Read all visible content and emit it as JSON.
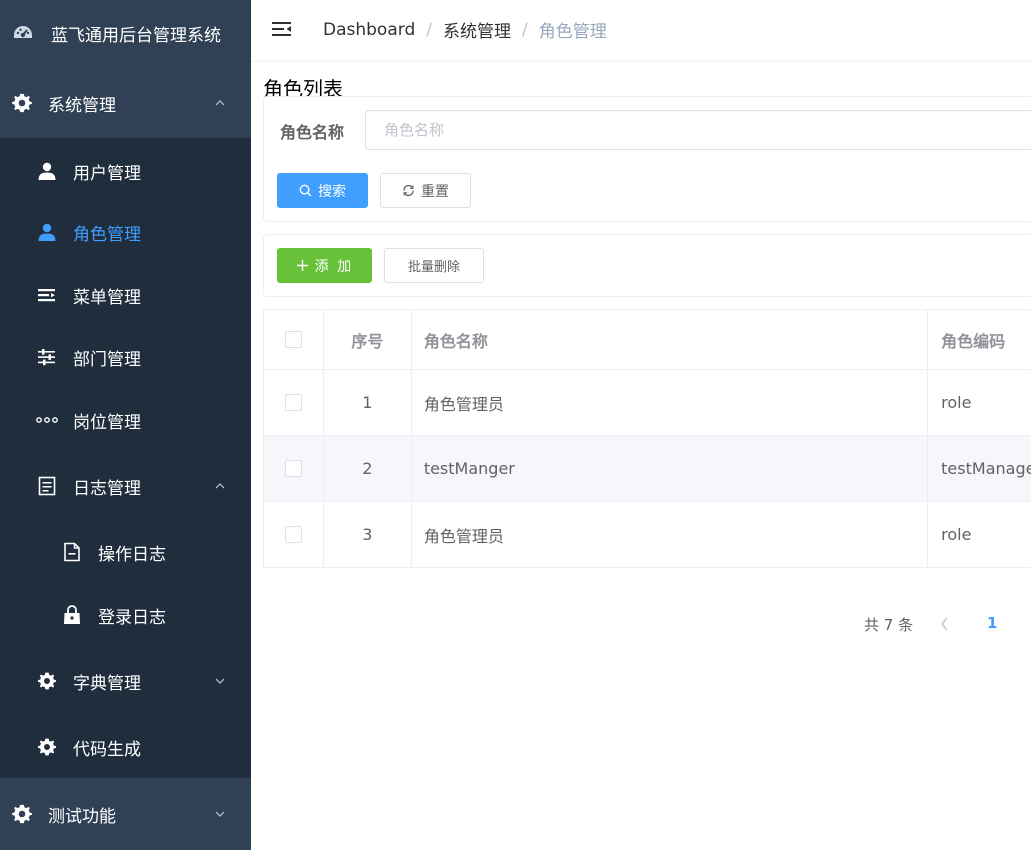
{
  "brand": {
    "title": "蓝飞通用后台管理系统",
    "icon": "dashboard-gauge-icon"
  },
  "sidebar": {
    "system_menu": {
      "label": "系统管理",
      "icon": "gear-icon",
      "expanded": true
    },
    "items": [
      {
        "label": "用户管理",
        "icon": "user-icon",
        "active": false
      },
      {
        "label": "角色管理",
        "icon": "user-icon",
        "active": true
      },
      {
        "label": "菜单管理",
        "icon": "menu-list-icon",
        "active": false
      },
      {
        "label": "部门管理",
        "icon": "sliders-icon",
        "active": false
      },
      {
        "label": "岗位管理",
        "icon": "more-dots-icon",
        "active": false
      },
      {
        "label": "日志管理",
        "icon": "document-icon",
        "expanded": true
      },
      {
        "label": "操作日志",
        "icon": "file-minus-icon",
        "active": false
      },
      {
        "label": "登录日志",
        "icon": "lock-bag-icon",
        "active": false
      },
      {
        "label": "字典管理",
        "icon": "gear-icon",
        "expanded": false
      },
      {
        "label": "代码生成",
        "icon": "gear-icon",
        "active": false
      }
    ],
    "test_menu": {
      "label": "测试功能",
      "icon": "gear-icon",
      "expanded": false
    }
  },
  "header": {
    "breadcrumb": [
      "Dashboard",
      "系统管理",
      "角色管理"
    ],
    "separator": "/"
  },
  "main": {
    "title": "角色列表",
    "search": {
      "label": "角色名称",
      "placeholder": "角色名称",
      "value": "",
      "search_button": "搜索",
      "reset_button": "重置"
    },
    "toolbar": {
      "add_button": "添 加",
      "batch_delete_button": "批量删除"
    },
    "table": {
      "columns": [
        "序号",
        "角色名称",
        "角色编码"
      ],
      "rows": [
        {
          "index": "1",
          "name": "角色管理员",
          "code": "role"
        },
        {
          "index": "2",
          "name": "testManger",
          "code": "testManage"
        },
        {
          "index": "3",
          "name": "角色管理员",
          "code": "role"
        }
      ]
    },
    "pagination": {
      "total_text": "共 7 条",
      "current_page": "1"
    }
  },
  "colors": {
    "sidebar_bg": "#304156",
    "submenu_bg": "#1f2d3d",
    "active_blue": "#409eff",
    "success_green": "#67c23a"
  }
}
